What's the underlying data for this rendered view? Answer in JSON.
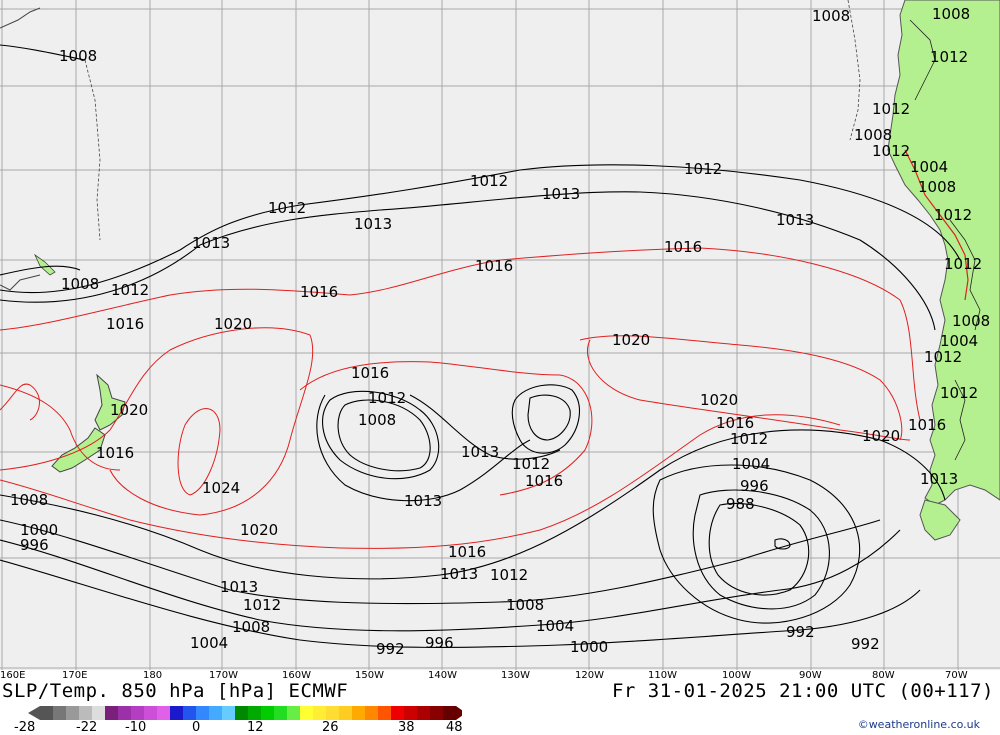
{
  "map": {
    "longitudes": [
      "160E",
      "170E",
      "180",
      "170W",
      "160W",
      "150W",
      "140W",
      "130W",
      "120W",
      "110W",
      "100W",
      "90W",
      "80W",
      "70W"
    ],
    "isobar_labels": {
      "v1008": "1008",
      "v1012": "1012",
      "v1013": "1013",
      "v1016": "1016",
      "v1020": "1020",
      "v1024": "1024",
      "v1004": "1004",
      "v1000": "1000",
      "v996": "996",
      "v992": "992",
      "v988": "988"
    }
  },
  "title": {
    "left": "SLP/Temp. 850 hPa [hPa] ECMWF",
    "right": "Fr 31-01-2025 21:00 UTC (00+117)"
  },
  "scale": {
    "labels": [
      "-28",
      "-22",
      "-10",
      "0",
      "12",
      "26",
      "38",
      "48"
    ],
    "colors": [
      "#555555",
      "#777777",
      "#999999",
      "#bbbbbb",
      "#dddddd",
      "#7a1f7a",
      "#9b30a8",
      "#b43ec2",
      "#cc4fd8",
      "#e060e8",
      "#1a1acc",
      "#2255ee",
      "#3388ff",
      "#44aaff",
      "#66ccff",
      "#008800",
      "#00aa00",
      "#00cc00",
      "#22dd22",
      "#66ee44",
      "#ffff33",
      "#ffee33",
      "#ffdd33",
      "#ffcc22",
      "#ffaa00",
      "#ff8800",
      "#ff5500",
      "#ee0000",
      "#cc0000",
      "#aa0000",
      "#880000",
      "#660000"
    ]
  },
  "credit": "©weatheronline.co.uk",
  "colors": {
    "ocean": "#efefef",
    "land": "#b4f090",
    "isobar_black": "#000000",
    "isobar_red": "#e02020",
    "grid": "#a0a0a0"
  }
}
